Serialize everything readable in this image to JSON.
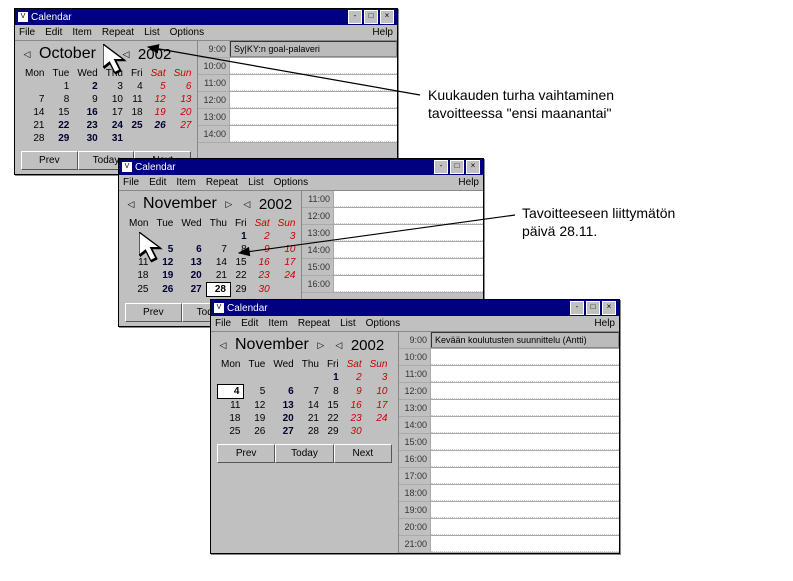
{
  "annotations": {
    "a1": "Kuukauden turha vaihtaminen\ntavoitteessa \"ensi maanantai\"",
    "a2": "Tavoitteeseen liittymätön\npäivä 28.11."
  },
  "common": {
    "app_title": "Calendar",
    "menu": {
      "file": "File",
      "edit": "Edit",
      "item": "Item",
      "repeat": "Repeat",
      "list": "List",
      "options": "Options",
      "help": "Help"
    },
    "buttons": {
      "prev": "Prev",
      "today": "Today",
      "next": "Next"
    },
    "dow": [
      "Mon",
      "Tue",
      "Wed",
      "Thu",
      "Fri",
      "Sat",
      "Sun"
    ]
  },
  "win1": {
    "month": "October",
    "year": "2002",
    "weeks": [
      [
        "",
        "1",
        "2",
        "3",
        "4",
        "5",
        "6"
      ],
      [
        "7",
        "8",
        "9",
        "10",
        "11",
        "12",
        "13"
      ],
      [
        "14",
        "15",
        "16",
        "17",
        "18",
        "19",
        "20"
      ],
      [
        "21",
        "22",
        "23",
        "24",
        "25",
        "26",
        "27"
      ],
      [
        "28",
        "29",
        "30",
        "31",
        "",
        "",
        ""
      ]
    ],
    "bold_days": [
      "2",
      "16",
      "22",
      "23",
      "24",
      "25",
      "26",
      "29",
      "30",
      "31"
    ],
    "times": [
      "9:00",
      "10:00",
      "11:00",
      "12:00",
      "13:00",
      "14:00"
    ],
    "event_time": "9:00",
    "event_label": "Sy|KY:n goal-palaveri"
  },
  "win2": {
    "month": "November",
    "year": "2002",
    "weeks": [
      [
        "",
        "",
        "",
        "",
        "1",
        "2",
        "3"
      ],
      [
        "4",
        "5",
        "6",
        "7",
        "8",
        "9",
        "10"
      ],
      [
        "11",
        "12",
        "13",
        "14",
        "15",
        "16",
        "17"
      ],
      [
        "18",
        "19",
        "20",
        "21",
        "22",
        "23",
        "24"
      ],
      [
        "25",
        "26",
        "27",
        "28",
        "29",
        "30",
        ""
      ]
    ],
    "bold_days": [
      "1",
      "5",
      "6",
      "12",
      "13",
      "19",
      "20",
      "26",
      "27"
    ],
    "boxed_day": "28",
    "times": [
      "11:00",
      "12:00",
      "13:00",
      "14:00",
      "15:00",
      "16:00"
    ]
  },
  "win3": {
    "month": "November",
    "year": "2002",
    "weeks": [
      [
        "",
        "",
        "",
        "",
        "1",
        "2",
        "3"
      ],
      [
        "4",
        "5",
        "6",
        "7",
        "8",
        "9",
        "10"
      ],
      [
        "11",
        "12",
        "13",
        "14",
        "15",
        "16",
        "17"
      ],
      [
        "18",
        "19",
        "20",
        "21",
        "22",
        "23",
        "24"
      ],
      [
        "25",
        "26",
        "27",
        "28",
        "29",
        "30",
        ""
      ]
    ],
    "bold_days": [
      "1",
      "6",
      "13",
      "20",
      "27"
    ],
    "boxed_day": "4",
    "times": [
      "9:00",
      "10:00",
      "11:00",
      "12:00",
      "13:00",
      "14:00",
      "15:00",
      "16:00",
      "17:00",
      "18:00",
      "19:00",
      "20:00",
      "21:00"
    ],
    "event_time": "9:00",
    "event_label": "Kevään koulutusten suunnittelu (Antti)"
  }
}
